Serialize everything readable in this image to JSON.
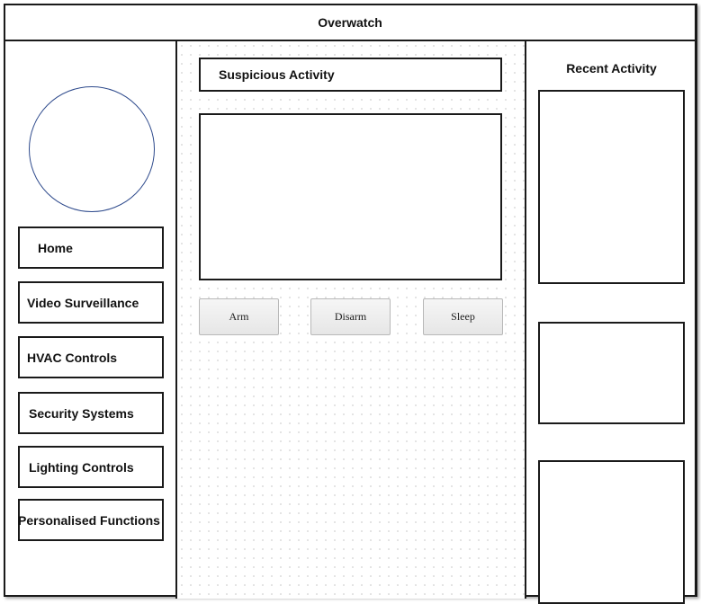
{
  "app": {
    "title": "Overwatch"
  },
  "sidebar": {
    "items": [
      {
        "label": "Home"
      },
      {
        "label": "Video Surveillance"
      },
      {
        "label": "HVAC Controls"
      },
      {
        "label": "Security Systems"
      },
      {
        "label": "Lighting Controls"
      },
      {
        "label": "Personalised Functions"
      }
    ]
  },
  "main": {
    "section_title": "Suspicious Activity",
    "buttons": {
      "arm": "Arm",
      "disarm": "Disarm",
      "sleep": "Sleep"
    }
  },
  "right": {
    "title": "Recent Activity"
  },
  "colors": {
    "border": "#1a1a1a",
    "avatar_outline": "#2e4a8c",
    "button_border": "#b8b8b8"
  }
}
